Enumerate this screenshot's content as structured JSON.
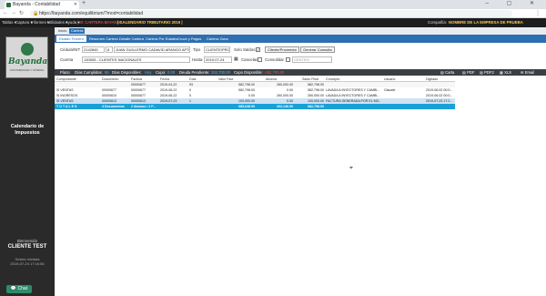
{
  "browser": {
    "tab_title": "Bayanda - Contabilidad",
    "url": "https://bayanda.com/equilibrium/?mod=contabilidad"
  },
  "menubar": {
    "items": [
      "Tablas ▾",
      "Captura ▾",
      "Informes ▾",
      "Utilidades ▾",
      "Ayuda ▾"
    ],
    "label1": "| M: CARTERA BAYANDA",
    "label2": "| CALENDARIO TRIBUTARIO 2019 |",
    "company_label": "Compañía:",
    "company_name": "NOMBRE DE LA EMPRESA DE PRUEBA"
  },
  "sidebar": {
    "logo_text": "Bayanda",
    "logo_sub": "CONTABILIDAD Y NÓMINA",
    "welcome": "Bienvenido",
    "client": "CLIENTE TEST",
    "session_label": "Sesión iniciada",
    "session_date": "2019-07-24 17:16:56",
    "calendar_line1": "Calendario de",
    "calendar_line2": "Impuestos",
    "chat_label": "Chat"
  },
  "topnav": {
    "items": [
      "Inicio",
      "Cartera"
    ]
  },
  "subnav": {
    "items": [
      "Estado Tercero",
      "Resumen Cartera",
      "Detalle Cartera",
      "Cartera Por Edades",
      "Cruce y Pagos",
      "Cartera Zona"
    ]
  },
  "form": {
    "cedula_label": "Cédula/NIT",
    "cedula_value": "2142845",
    "cedula_dv": "8",
    "tercero_value": "JUAN GUILLERMO CADAVID ARANGO APTO",
    "tipo_label": "Tipo",
    "tipo_value": "CLIENTE/PROVE",
    "solo_saldos_label": "Solo Saldos",
    "solo_saldos_checked": "✓",
    "btn_cliente": "Cliente/Proveedor",
    "btn_generar": "Generar Consulta",
    "cuenta_label": "Cuenta",
    "cuenta_value": "130505 - CLIENTES NACIONALES",
    "hasta_label": "Hasta",
    "hasta_value": "2019-07-24",
    "canceladas_label": "Canceladas",
    "consolidar_label": "Consolidar",
    "centro_value": "CENTRO"
  },
  "status": {
    "plazo_label": "Plazo:",
    "dias_comp_label": "Días Cumplidos:",
    "dias_comp_value": "95",
    "dias_disp_label": "Días Disponibles:",
    "dias_disp_value": "Hoy",
    "cupo_label": "Cupo:",
    "cupo_value": "0.00",
    "deuda_label": "Deuda Pendiente:",
    "deuda_value": "262,700.00",
    "cupo_disp_label": "Cupo Disponible:",
    "cupo_disp_value": "-262,700.00",
    "exports": [
      "Carta",
      "PDF",
      "PDF2",
      "XLS",
      "Email"
    ]
  },
  "table": {
    "headers": [
      "Comprobante",
      "Documento",
      "Factura",
      "Fecha",
      "Días",
      "Valor Fact.",
      "Abonos",
      "Saldo Final",
      "Concepto",
      "Usuario",
      "Digitado"
    ],
    "rows": [
      [
        "",
        "",
        "00000677",
        "2019-04-22",
        "93",
        "582,798.00",
        "260,000.00",
        "582,798.00",
        "",
        "",
        ""
      ],
      [
        "SI VENTAS",
        "00000677",
        "00000677",
        "2019-06-22",
        "0",
        "582,798.00",
        "0.00",
        "582,798.00",
        "LAVADA A INYECTORES Y CAMBI...",
        "Claudet",
        "2019-06-02 00:0..."
      ],
      [
        "SI INGRESOS",
        "00000610",
        "00000677",
        "2019-06-22",
        "0",
        "0.00",
        "260,000.00",
        "260,000.00",
        "LAVADA A INYECTORES Y CAMBI...",
        "",
        "2019-06-02 00:0..."
      ],
      [
        "SI VENTAS",
        "00000613",
        "00000613",
        "2019-07-23",
        "1",
        "100,000.00",
        "0.00",
        "100,000.00",
        "FACTURA GENERADA POR EL MO...",
        "",
        "2019-07-23 17:2..."
      ],
      [
        "T O T A L E S",
        "4 Documentos",
        "2 Abonos / 2 F...",
        "",
        "",
        "685,648.00",
        "262,146.00",
        "682,798.00",
        "",
        "",
        ""
      ]
    ]
  }
}
